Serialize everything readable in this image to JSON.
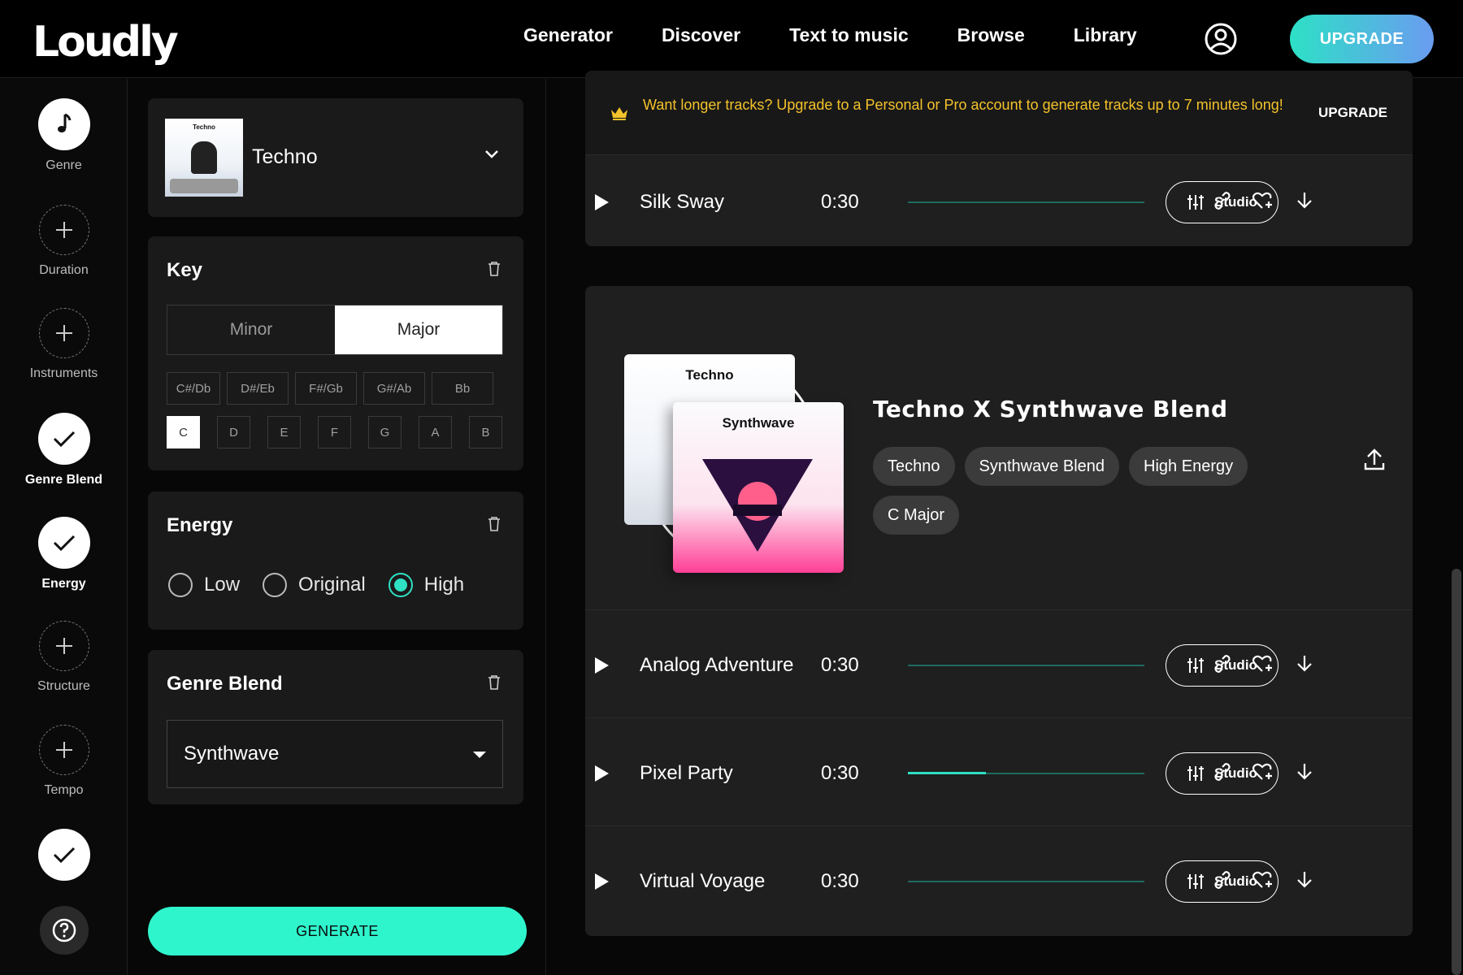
{
  "header": {
    "logo": "Loudly",
    "nav": [
      "Generator",
      "Discover",
      "Text to music",
      "Browse",
      "Library"
    ],
    "upgrade_label": "UPGRADE"
  },
  "rail": {
    "steps": [
      {
        "label": "Genre",
        "state": "music"
      },
      {
        "label": "Duration",
        "state": "add"
      },
      {
        "label": "Instruments",
        "state": "add"
      },
      {
        "label": "Genre Blend",
        "state": "done"
      },
      {
        "label": "Energy",
        "state": "done"
      },
      {
        "label": "Structure",
        "state": "add"
      },
      {
        "label": "Tempo",
        "state": "add"
      }
    ]
  },
  "panel": {
    "genre": {
      "name": "Techno",
      "thumb_title": "Techno"
    },
    "key": {
      "title": "Key",
      "modes": [
        "Minor",
        "Major"
      ],
      "selected_mode": "Major",
      "sharps": [
        "C#/Db",
        "D#/Eb",
        "F#/Gb",
        "G#/Ab",
        "Bb"
      ],
      "naturals": [
        "C",
        "D",
        "E",
        "F",
        "G",
        "A",
        "B"
      ],
      "selected_key": "C"
    },
    "energy": {
      "title": "Energy",
      "options": [
        "Low",
        "Original",
        "High"
      ],
      "selected": "High"
    },
    "genre_blend": {
      "title": "Genre Blend",
      "value": "Synthwave"
    },
    "generate_label": "GENERATE"
  },
  "main": {
    "banner": {
      "text": "Want longer tracks? Upgrade to a Personal or Pro account to generate tracks up to 7 minutes long!",
      "action": "UPGRADE"
    },
    "studio_label": "Studio",
    "first_track": {
      "name": "Silk Sway",
      "duration": "0:30",
      "progress": 0
    },
    "hero": {
      "title": "Techno X Synthwave Blend",
      "cover_a": "Techno",
      "cover_b": "Synthwave",
      "tags": [
        "Techno",
        "Synthwave Blend",
        "High Energy",
        "C Major"
      ]
    },
    "tracks": [
      {
        "name": "Analog Adventure",
        "duration": "0:30",
        "progress": 0
      },
      {
        "name": "Pixel Party",
        "duration": "0:30",
        "progress": 0.33
      },
      {
        "name": "Virtual Voyage",
        "duration": "0:30",
        "progress": 0
      }
    ]
  },
  "colors": {
    "accent": "#2fe0c3",
    "banner_text": "#f4c22b",
    "generate": "#2ff5cd"
  }
}
